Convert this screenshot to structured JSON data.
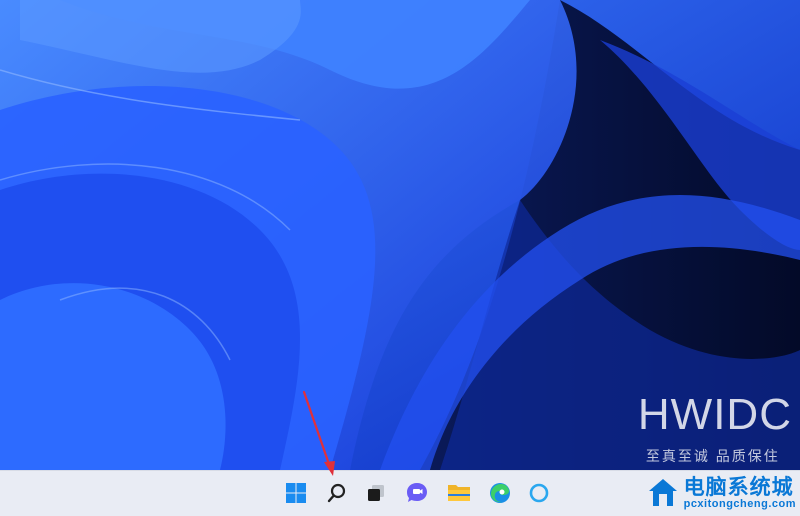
{
  "watermark": {
    "title": "HWIDC",
    "subtitle": "至真至诚 品质保住"
  },
  "site_logo": {
    "name": "电脑系统城",
    "url": "pcxitongcheng.com"
  },
  "taskbar": {
    "icons": [
      "start-windows-icon",
      "search-icon",
      "task-view-icon",
      "chat-icon",
      "file-explorer-icon",
      "edge-browser-icon",
      "cortana-icon"
    ]
  },
  "colors": {
    "taskbar_bg": "#e9ecf4",
    "annotation_arrow": "#e0303a",
    "accent": "#0a78d6"
  }
}
